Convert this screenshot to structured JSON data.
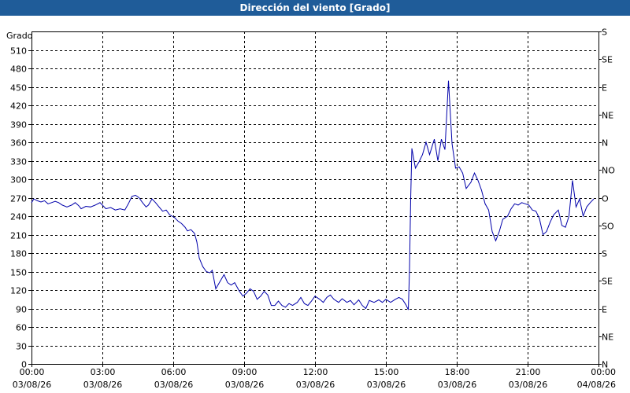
{
  "window": {
    "title": "Dirección del viento [Grado]"
  },
  "colors": {
    "titlebar": "#1f5c99",
    "line": "#0000aa",
    "grid": "#000000"
  },
  "chart_data": {
    "type": "line",
    "title": "Dirección del viento [Grado]",
    "ylabel": "Grado",
    "ylim": [
      0,
      540
    ],
    "yticks": [
      0,
      30,
      60,
      90,
      120,
      150,
      180,
      210,
      240,
      270,
      300,
      330,
      360,
      390,
      420,
      450,
      480,
      510
    ],
    "xlim_hours": [
      0,
      24
    ],
    "xticks": [
      {
        "h": 0,
        "time": "00:00",
        "date": "03/08/26"
      },
      {
        "h": 3,
        "time": "03:00",
        "date": "03/08/26"
      },
      {
        "h": 6,
        "time": "06:00",
        "date": "03/08/26"
      },
      {
        "h": 9,
        "time": "09:00",
        "date": "03/08/26"
      },
      {
        "h": 12,
        "time": "12:00",
        "date": "03/08/26"
      },
      {
        "h": 15,
        "time": "15:00",
        "date": "03/08/26"
      },
      {
        "h": 18,
        "time": "18:00",
        "date": "03/08/26"
      },
      {
        "h": 21,
        "time": "21:00",
        "date": "03/08/26"
      },
      {
        "h": 24,
        "time": "00:00",
        "date": "04/08/26"
      }
    ],
    "right_axis": [
      {
        "value": 540,
        "label": "S"
      },
      {
        "value": 495,
        "label": "SE"
      },
      {
        "value": 450,
        "label": "E"
      },
      {
        "value": 405,
        "label": "NE"
      },
      {
        "value": 360,
        "label": "N"
      },
      {
        "value": 315,
        "label": "NO"
      },
      {
        "value": 270,
        "label": "O"
      },
      {
        "value": 225,
        "label": "SO"
      },
      {
        "value": 180,
        "label": "S"
      },
      {
        "value": 135,
        "label": "SE"
      },
      {
        "value": 90,
        "label": "E"
      },
      {
        "value": 45,
        "label": "NE"
      },
      {
        "value": 0,
        "label": "N"
      }
    ],
    "grid": true,
    "series": [
      {
        "values": [
          [
            0.0,
            262
          ],
          [
            0.1,
            268
          ],
          [
            0.25,
            265
          ],
          [
            0.4,
            263
          ],
          [
            0.55,
            265
          ],
          [
            0.7,
            260
          ],
          [
            0.85,
            262
          ],
          [
            1.0,
            264
          ],
          [
            1.15,
            262
          ],
          [
            1.3,
            258
          ],
          [
            1.5,
            255
          ],
          [
            1.7,
            258
          ],
          [
            1.85,
            262
          ],
          [
            2.0,
            257
          ],
          [
            2.1,
            252
          ],
          [
            2.3,
            256
          ],
          [
            2.5,
            255
          ],
          [
            2.7,
            258
          ],
          [
            2.9,
            262
          ],
          [
            3.0,
            258
          ],
          [
            3.15,
            252
          ],
          [
            3.35,
            254
          ],
          [
            3.55,
            250
          ],
          [
            3.75,
            252
          ],
          [
            3.95,
            250
          ],
          [
            4.1,
            260
          ],
          [
            4.25,
            272
          ],
          [
            4.4,
            274
          ],
          [
            4.55,
            270
          ],
          [
            4.7,
            262
          ],
          [
            4.85,
            255
          ],
          [
            4.95,
            258
          ],
          [
            5.1,
            268
          ],
          [
            5.25,
            262
          ],
          [
            5.4,
            255
          ],
          [
            5.55,
            248
          ],
          [
            5.7,
            250
          ],
          [
            5.85,
            242
          ],
          [
            6.05,
            238
          ],
          [
            6.2,
            232
          ],
          [
            6.35,
            228
          ],
          [
            6.5,
            222
          ],
          [
            6.6,
            216
          ],
          [
            6.75,
            218
          ],
          [
            6.9,
            212
          ],
          [
            7.0,
            198
          ],
          [
            7.1,
            172
          ],
          [
            7.25,
            158
          ],
          [
            7.4,
            150
          ],
          [
            7.55,
            148
          ],
          [
            7.65,
            152
          ],
          [
            7.8,
            122
          ],
          [
            7.95,
            132
          ],
          [
            8.15,
            145
          ],
          [
            8.3,
            132
          ],
          [
            8.45,
            128
          ],
          [
            8.6,
            132
          ],
          [
            8.8,
            118
          ],
          [
            8.95,
            110
          ],
          [
            9.1,
            115
          ],
          [
            9.25,
            122
          ],
          [
            9.4,
            118
          ],
          [
            9.55,
            105
          ],
          [
            9.7,
            110
          ],
          [
            9.85,
            118
          ],
          [
            10.0,
            112
          ],
          [
            10.15,
            95
          ],
          [
            10.3,
            95
          ],
          [
            10.45,
            102
          ],
          [
            10.6,
            95
          ],
          [
            10.75,
            92
          ],
          [
            10.9,
            98
          ],
          [
            11.05,
            95
          ],
          [
            11.25,
            100
          ],
          [
            11.4,
            108
          ],
          [
            11.55,
            98
          ],
          [
            11.7,
            95
          ],
          [
            11.85,
            102
          ],
          [
            12.0,
            110
          ],
          [
            12.2,
            105
          ],
          [
            12.35,
            100
          ],
          [
            12.5,
            108
          ],
          [
            12.65,
            112
          ],
          [
            12.8,
            105
          ],
          [
            13.0,
            100
          ],
          [
            13.15,
            106
          ],
          [
            13.35,
            100
          ],
          [
            13.5,
            103
          ],
          [
            13.65,
            96
          ],
          [
            13.85,
            104
          ],
          [
            14.0,
            95
          ],
          [
            14.15,
            90
          ],
          [
            14.3,
            103
          ],
          [
            14.5,
            100
          ],
          [
            14.7,
            104
          ],
          [
            14.85,
            100
          ],
          [
            15.0,
            105
          ],
          [
            15.2,
            100
          ],
          [
            15.4,
            105
          ],
          [
            15.55,
            108
          ],
          [
            15.7,
            105
          ],
          [
            15.85,
            96
          ],
          [
            15.95,
            88
          ],
          [
            16.0,
            152
          ],
          [
            16.05,
            268
          ],
          [
            16.1,
            350
          ],
          [
            16.25,
            318
          ],
          [
            16.4,
            328
          ],
          [
            16.55,
            340
          ],
          [
            16.7,
            360
          ],
          [
            16.85,
            340
          ],
          [
            17.05,
            365
          ],
          [
            17.2,
            330
          ],
          [
            17.35,
            365
          ],
          [
            17.5,
            348
          ],
          [
            17.65,
            460
          ],
          [
            17.8,
            358
          ],
          [
            17.95,
            318
          ],
          [
            18.1,
            320
          ],
          [
            18.25,
            310
          ],
          [
            18.4,
            285
          ],
          [
            18.6,
            295
          ],
          [
            18.75,
            310
          ],
          [
            18.9,
            298
          ],
          [
            19.05,
            282
          ],
          [
            19.2,
            260
          ],
          [
            19.35,
            250
          ],
          [
            19.5,
            215
          ],
          [
            19.65,
            200
          ],
          [
            19.8,
            215
          ],
          [
            19.95,
            235
          ],
          [
            20.15,
            240
          ],
          [
            20.3,
            252
          ],
          [
            20.45,
            260
          ],
          [
            20.6,
            258
          ],
          [
            20.75,
            262
          ],
          [
            20.9,
            260
          ],
          [
            21.05,
            258
          ],
          [
            21.2,
            250
          ],
          [
            21.35,
            248
          ],
          [
            21.5,
            236
          ],
          [
            21.65,
            210
          ],
          [
            21.8,
            215
          ],
          [
            21.95,
            230
          ],
          [
            22.1,
            242
          ],
          [
            22.3,
            250
          ],
          [
            22.45,
            225
          ],
          [
            22.6,
            222
          ],
          [
            22.75,
            240
          ],
          [
            22.9,
            298
          ],
          [
            23.05,
            255
          ],
          [
            23.2,
            268
          ],
          [
            23.35,
            240
          ],
          [
            23.5,
            255
          ],
          [
            23.65,
            262
          ],
          [
            23.8,
            268
          ]
        ]
      }
    ]
  }
}
